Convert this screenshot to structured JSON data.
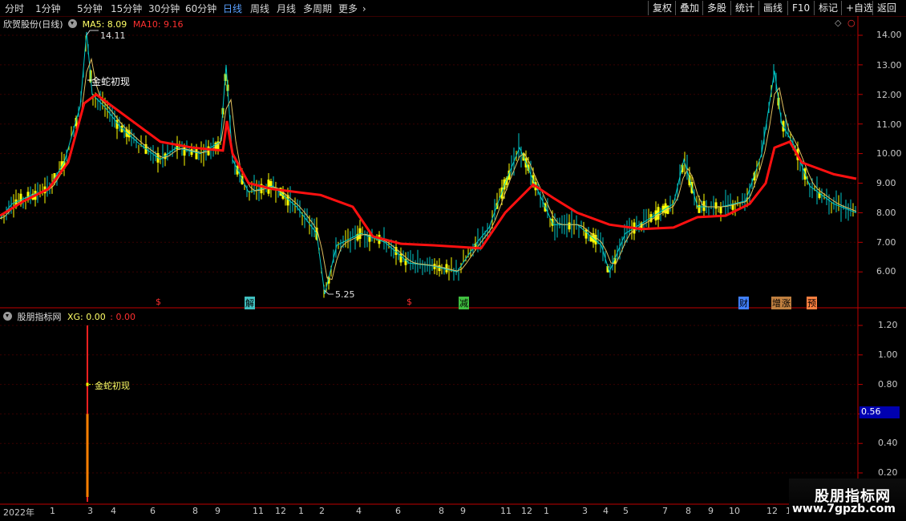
{
  "toolbar": {
    "timeframes": [
      "分时",
      "1分钟",
      "5分钟",
      "15分钟",
      "30分钟",
      "60分钟",
      "日线",
      "周线",
      "月线",
      "多周期",
      "更多"
    ],
    "active_timeframe": "日线",
    "buttons": [
      "复权",
      "叠加",
      "多股",
      "统计",
      "画线",
      "F10",
      "标记",
      "+自选",
      "返回"
    ]
  },
  "main_panel": {
    "stock_title": "欣贺股份(日线)",
    "ma5_label": "MA5: 8.09",
    "ma10_label": "MA10: 9.16",
    "high_marker": "14.11",
    "low_marker": "5.25",
    "signal_label": "金蛇初现",
    "event_markers": [
      "$",
      "解",
      "$",
      "减",
      "财",
      "增",
      "涨",
      "预"
    ],
    "y_ticks": [
      "14.00",
      "13.00",
      "12.00",
      "11.00",
      "10.00",
      "9.00",
      "8.00",
      "7.00",
      "6.00"
    ]
  },
  "sub_panel": {
    "title": "股朋指标网",
    "xg_label": "XG: 0.00",
    "second_label": ": 0.00",
    "signal_label": "金蛇初现",
    "y_ticks": [
      "1.20",
      "1.00",
      "0.80",
      "0.56",
      "0.40",
      "0.20"
    ],
    "cursor_value": "0.56"
  },
  "x_axis": {
    "labels": [
      "2022年",
      "1",
      "3",
      "4",
      "6",
      "8",
      "9",
      "11",
      "12",
      "1",
      "2",
      "4",
      "6",
      "8",
      "9",
      "11",
      "12",
      "1",
      "3",
      "4",
      "5",
      "7",
      "8",
      "9",
      "10",
      "12",
      "1"
    ]
  },
  "watermark": {
    "title": "股朋指标网",
    "url": "www.7gpzb.com"
  },
  "colors": {
    "up": "#ffff00",
    "down": "#00c8c8",
    "ma_thick": "#ff1010",
    "ma_thin": "#e0c060",
    "grid": "#3a0000",
    "axis": "#c00000",
    "active": "#5aa0ff"
  },
  "chart_data": {
    "type": "line",
    "title": "欣贺股份(日线)",
    "ylim": [
      5.0,
      14.5
    ],
    "annotations": [
      "14.11",
      "5.25",
      "金蛇初现"
    ],
    "series": [
      {
        "name": "MA5",
        "last": 8.09
      },
      {
        "name": "MA10",
        "last": 9.16
      }
    ],
    "price_path": [
      [
        0,
        7.8
      ],
      [
        15,
        8.3
      ],
      [
        40,
        8.6
      ],
      [
        60,
        8.8
      ],
      [
        80,
        9.7
      ],
      [
        100,
        11.6
      ],
      [
        108,
        14.11
      ],
      [
        115,
        12.0
      ],
      [
        130,
        11.6
      ],
      [
        150,
        10.9
      ],
      [
        175,
        10.3
      ],
      [
        200,
        9.8
      ],
      [
        220,
        10.2
      ],
      [
        250,
        10.0
      ],
      [
        275,
        10.4
      ],
      [
        282,
        13.0
      ],
      [
        290,
        9.8
      ],
      [
        310,
        8.7
      ],
      [
        340,
        8.9
      ],
      [
        370,
        8.2
      ],
      [
        395,
        7.3
      ],
      [
        405,
        5.25
      ],
      [
        420,
        6.9
      ],
      [
        450,
        7.3
      ],
      [
        480,
        7.0
      ],
      [
        510,
        6.3
      ],
      [
        540,
        6.2
      ],
      [
        570,
        6.0
      ],
      [
        595,
        7.0
      ],
      [
        610,
        7.5
      ],
      [
        630,
        9.0
      ],
      [
        648,
        10.2
      ],
      [
        665,
        9.1
      ],
      [
        690,
        7.6
      ],
      [
        720,
        7.6
      ],
      [
        750,
        6.9
      ],
      [
        760,
        6.0
      ],
      [
        780,
        7.3
      ],
      [
        810,
        7.8
      ],
      [
        840,
        8.3
      ],
      [
        853,
        9.8
      ],
      [
        870,
        8.2
      ],
      [
        900,
        8.2
      ],
      [
        930,
        8.4
      ],
      [
        950,
        10.0
      ],
      [
        966,
        12.8
      ],
      [
        975,
        11.0
      ],
      [
        990,
        10.3
      ],
      [
        1010,
        8.9
      ],
      [
        1040,
        8.3
      ],
      [
        1068,
        8.0
      ]
    ],
    "ma_thick_path": [
      [
        0,
        7.9
      ],
      [
        30,
        8.4
      ],
      [
        60,
        8.8
      ],
      [
        85,
        9.7
      ],
      [
        105,
        11.7
      ],
      [
        120,
        12.0
      ],
      [
        160,
        11.2
      ],
      [
        200,
        10.4
      ],
      [
        240,
        10.2
      ],
      [
        278,
        10.1
      ],
      [
        283,
        11.1
      ],
      [
        290,
        10.0
      ],
      [
        310,
        9.0
      ],
      [
        340,
        8.8
      ],
      [
        400,
        8.6
      ],
      [
        440,
        8.2
      ],
      [
        465,
        7.2
      ],
      [
        500,
        6.95
      ],
      [
        540,
        6.9
      ],
      [
        600,
        6.8
      ],
      [
        630,
        8.0
      ],
      [
        665,
        8.95
      ],
      [
        690,
        8.5
      ],
      [
        720,
        8.0
      ],
      [
        760,
        7.6
      ],
      [
        800,
        7.45
      ],
      [
        840,
        7.5
      ],
      [
        870,
        7.85
      ],
      [
        905,
        7.9
      ],
      [
        935,
        8.3
      ],
      [
        955,
        9.0
      ],
      [
        966,
        10.2
      ],
      [
        985,
        10.4
      ],
      [
        1000,
        9.7
      ],
      [
        1040,
        9.3
      ],
      [
        1068,
        9.15
      ]
    ],
    "indicator": {
      "name": "XG",
      "signal_x": 109,
      "signal_value": 0.8,
      "peak": 1.2,
      "current": 0.0
    }
  }
}
